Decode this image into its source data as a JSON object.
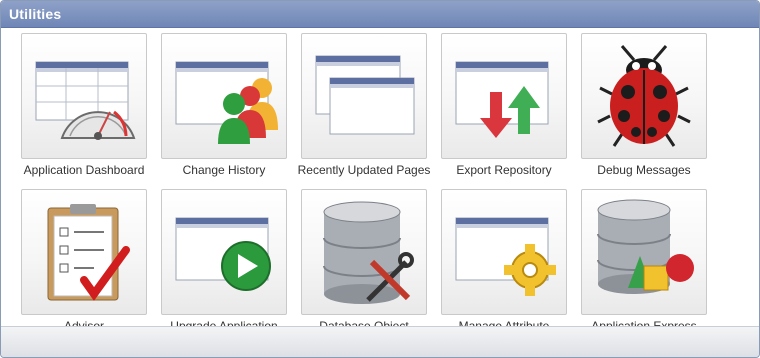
{
  "panel": {
    "title": "Utilities"
  },
  "tiles": [
    {
      "label": "Application Dashboard",
      "icon": "dashboard-gauge-icon"
    },
    {
      "label": "Change History",
      "icon": "people-history-icon"
    },
    {
      "label": "Recently Updated Pages",
      "icon": "stacked-pages-icon"
    },
    {
      "label": "Export Repository",
      "icon": "export-arrows-icon"
    },
    {
      "label": "Debug Messages",
      "icon": "ladybug-icon"
    },
    {
      "label": "Advisor",
      "icon": "clipboard-check-icon"
    },
    {
      "label": "Upgrade Application",
      "icon": "play-upgrade-icon"
    },
    {
      "label": "Database Object Dependencies",
      "icon": "database-tools-icon"
    },
    {
      "label": "Manage Attribute Dictionary",
      "icon": "gear-dictionary-icon"
    },
    {
      "label": "Application Express Views",
      "icon": "database-shapes-icon"
    }
  ]
}
